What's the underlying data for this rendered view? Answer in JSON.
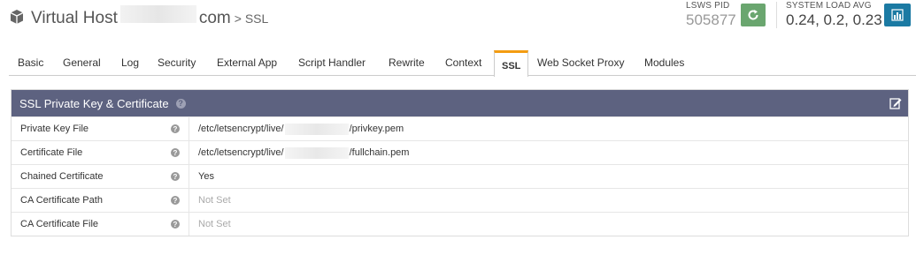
{
  "header": {
    "title": "Virtual Host",
    "domain_suffix": "com",
    "crumb": "> SSL",
    "pid_label": "LSWS PID",
    "pid_value": "505877",
    "load_label": "SYSTEM LOAD AVG",
    "load_value": "0.24, 0.2, 0.23",
    "restart_icon": "refresh-icon",
    "stats_icon": "bar-chart-icon"
  },
  "tabs": [
    {
      "label": "Basic"
    },
    {
      "label": "General"
    },
    {
      "label": "Log"
    },
    {
      "label": "Security"
    },
    {
      "label": "External App"
    },
    {
      "label": "Script Handler"
    },
    {
      "label": "Rewrite"
    },
    {
      "label": "Context"
    },
    {
      "label": "SSL",
      "active": true
    },
    {
      "label": "Web Socket Proxy"
    },
    {
      "label": "Modules"
    }
  ],
  "panel": {
    "title": "SSL Private Key & Certificate",
    "rows": [
      {
        "label": "Private Key File",
        "value_prefix": "/etc/letsencrypt/live/",
        "value_suffix": "/privkey.pem"
      },
      {
        "label": "Certificate File",
        "value_prefix": "/etc/letsencrypt/live/",
        "value_suffix": "/fullchain.pem"
      },
      {
        "label": "Chained Certificate",
        "value": "Yes"
      },
      {
        "label": "CA Certificate Path",
        "value": "Not Set"
      },
      {
        "label": "CA Certificate File",
        "value": "Not Set"
      }
    ]
  },
  "colors": {
    "panel_header": "#5d6280",
    "active_tab_accent": "#f39c12",
    "restart_button": "#6aa66f",
    "stats_button": "#1b7aa3"
  }
}
